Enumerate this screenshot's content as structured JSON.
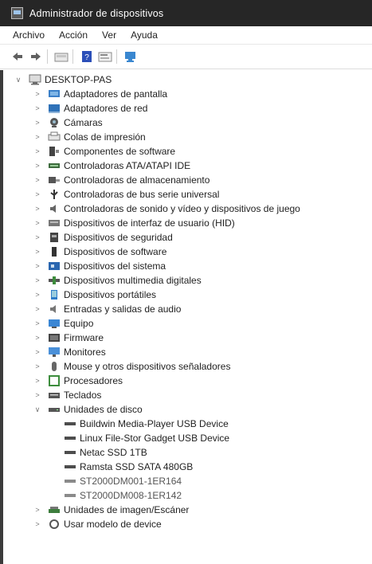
{
  "window": {
    "title": "Administrador de dispositivos"
  },
  "menu": [
    "Archivo",
    "Acción",
    "Ver",
    "Ayuda"
  ],
  "toolbar": {
    "icons": [
      "back-arrow-icon",
      "forward-arrow-icon",
      "device-view-icon",
      "help-icon",
      "properties-icon",
      "scan-hardware-icon"
    ]
  },
  "tree": {
    "root": "DESKTOP-PAS",
    "categories": [
      "Adaptadores de pantalla",
      "Adaptadores de red",
      "Cámaras",
      "Colas de impresión",
      "Componentes de software",
      "Controladoras ATA/ATAPI IDE",
      "Controladoras de almacenamiento",
      "Controladoras de bus serie universal",
      "Controladoras de sonido y vídeo y dispositivos de juego",
      "Dispositivos de interfaz de usuario (HID)",
      "Dispositivos de seguridad",
      "Dispositivos de software",
      "Dispositivos del sistema",
      "Dispositivos multimedia digitales",
      "Dispositivos portátiles",
      "Entradas y salidas de audio",
      "Equipo",
      "Firmware",
      "Monitores",
      "Mouse y otros dispositivos señaladores",
      "Procesadores",
      "Teclados",
      "Unidades de disco"
    ],
    "disk_drives": [
      "Buildwin Media-Player USB Device",
      "Linux File-Stor Gadget USB Device",
      "Netac SSD 1TB",
      "Ramsta SSD SATA 480GB",
      "ST2000DM001-1ER164",
      "ST2000DM008-1ER142"
    ],
    "trailing": [
      "Unidades de imagen/Escáner",
      "Usar modelo de device"
    ]
  }
}
